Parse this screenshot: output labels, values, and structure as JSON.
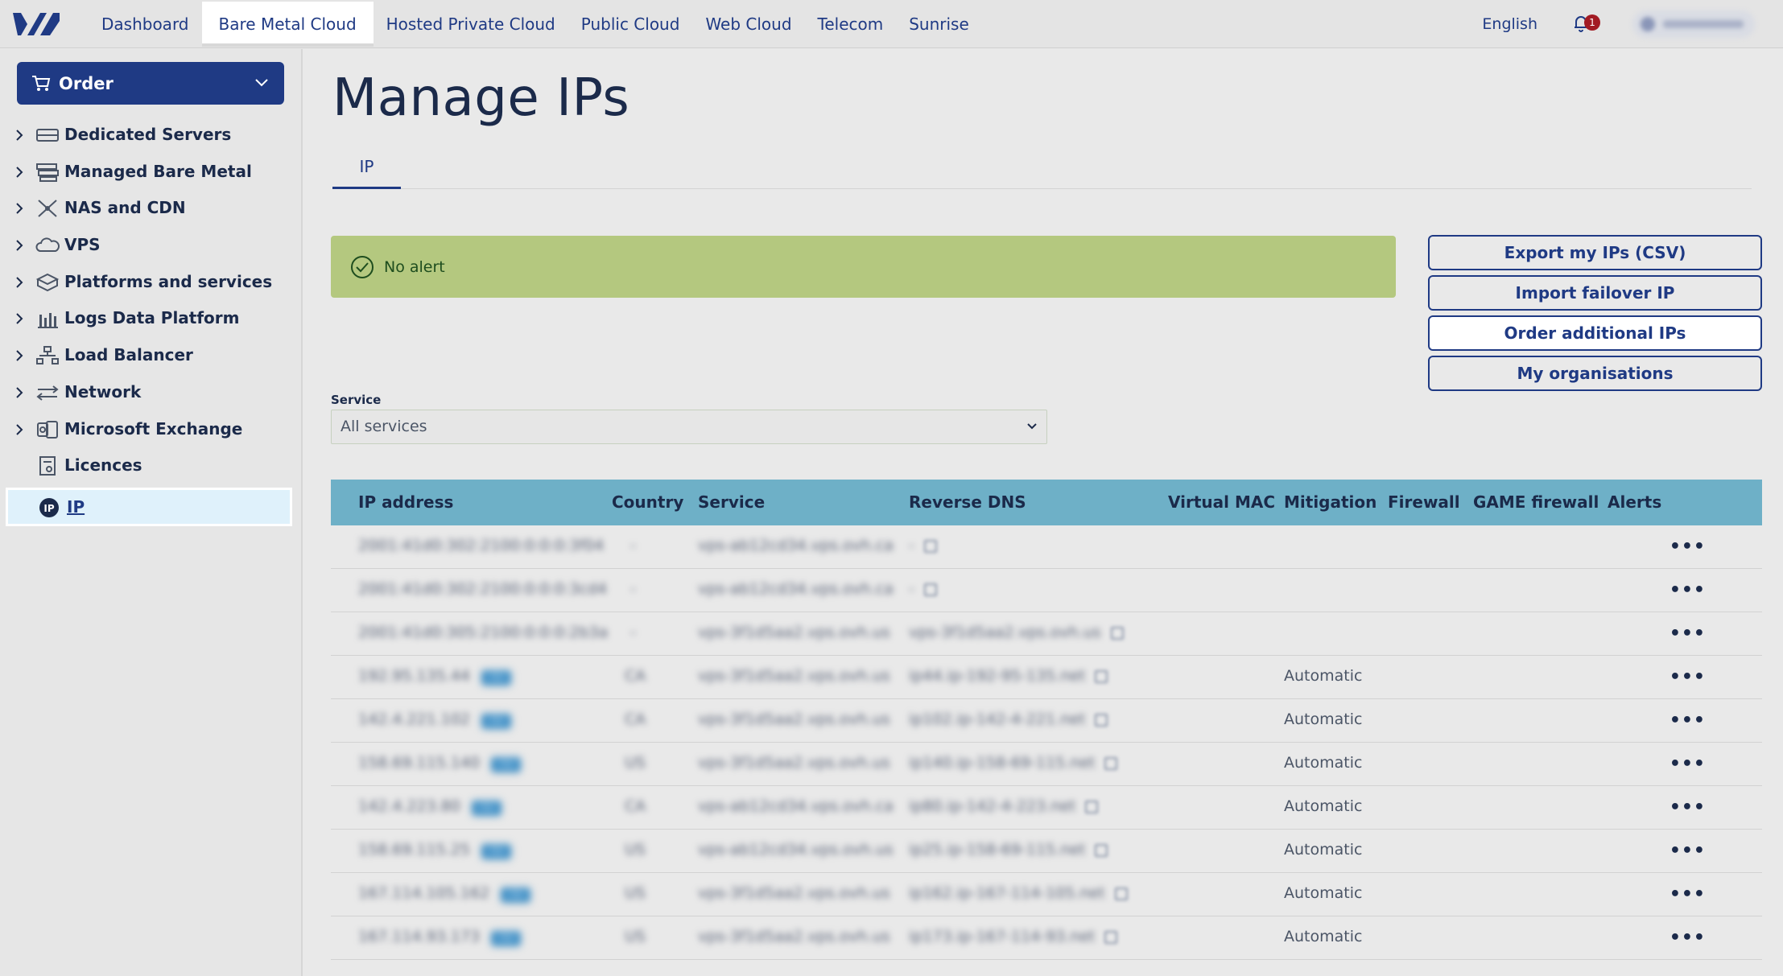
{
  "topnav": {
    "items": [
      {
        "label": "Dashboard",
        "active": false
      },
      {
        "label": "Bare Metal Cloud",
        "active": true
      },
      {
        "label": "Hosted Private Cloud",
        "active": false
      },
      {
        "label": "Public Cloud",
        "active": false
      },
      {
        "label": "Web Cloud",
        "active": false
      },
      {
        "label": "Telecom",
        "active": false
      },
      {
        "label": "Sunrise",
        "active": false
      }
    ],
    "language": "English",
    "notifications_count": "1"
  },
  "sidebar": {
    "order_label": "Order",
    "items": [
      {
        "label": "Dedicated Servers",
        "icon": "server-icon",
        "expandable": true
      },
      {
        "label": "Managed Bare Metal",
        "icon": "stack-icon",
        "expandable": true
      },
      {
        "label": "NAS and CDN",
        "icon": "network-nodes-icon",
        "expandable": true
      },
      {
        "label": "VPS",
        "icon": "cloud-icon",
        "expandable": true
      },
      {
        "label": "Platforms and services",
        "icon": "cubes-icon",
        "expandable": true
      },
      {
        "label": "Logs Data Platform",
        "icon": "bar-chart-icon",
        "expandable": true
      },
      {
        "label": "Load Balancer",
        "icon": "load-balancer-icon",
        "expandable": true
      },
      {
        "label": "Network",
        "icon": "arrows-icon",
        "expandable": true
      },
      {
        "label": "Microsoft Exchange",
        "icon": "exchange-icon",
        "expandable": true
      },
      {
        "label": "Licences",
        "icon": "licence-icon",
        "expandable": false
      },
      {
        "label": "IP",
        "icon": "ip-icon",
        "expandable": false,
        "selected": true
      }
    ]
  },
  "page": {
    "title": "Manage IPs",
    "tab": "IP"
  },
  "alert": {
    "text": "No alert",
    "color": "#b4c87f"
  },
  "actions": {
    "export": "Export my IPs (CSV)",
    "import": "Import failover IP",
    "order": "Order additional IPs",
    "orgs": "My organisations"
  },
  "service_filter": {
    "label": "Service",
    "value": "All services"
  },
  "table": {
    "headers": {
      "ip": "IP address",
      "country": "Country",
      "service": "Service",
      "rdns": "Reverse DNS",
      "mac": "Virtual MAC",
      "mitigation": "Mitigation",
      "firewall": "Firewall",
      "game": "GAME firewall",
      "alerts": "Alerts"
    },
    "rows": [
      {
        "ip": "2001:41d0:302:2100:0:0:0:3f04",
        "tag": "",
        "country": "-",
        "service": "vps-ab12cd34.vps.ovh.ca",
        "rdns": "-",
        "mitigation": ""
      },
      {
        "ip": "2001:41d0:302:2100:0:0:0:3cd4",
        "tag": "",
        "country": "-",
        "service": "vps-ab12cd34.vps.ovh.ca",
        "rdns": "-",
        "mitigation": ""
      },
      {
        "ip": "2001:41d0:305:2100:0:0:0:2b3a",
        "tag": "",
        "country": "-",
        "service": "vps-3f1d5aa2.vps.ovh.us",
        "rdns": "vps-3f1d5aa2.vps.ovh.us",
        "mitigation": ""
      },
      {
        "ip": "192.95.135.44",
        "tag": "/32",
        "country": "CA",
        "service": "vps-3f1d5aa2.vps.ovh.us",
        "rdns": "ip44.ip-192-95-135.net",
        "mitigation": "Automatic"
      },
      {
        "ip": "142.4.221.102",
        "tag": "/32",
        "country": "CA",
        "service": "vps-3f1d5aa2.vps.ovh.us",
        "rdns": "ip102.ip-142-4-221.net",
        "mitigation": "Automatic"
      },
      {
        "ip": "158.69.115.140",
        "tag": "/32",
        "country": "US",
        "service": "vps-3f1d5aa2.vps.ovh.us",
        "rdns": "ip140.ip-158-69-115.net",
        "mitigation": "Automatic"
      },
      {
        "ip": "142.4.223.80",
        "tag": "/32",
        "country": "CA",
        "service": "vps-ab12cd34.vps.ovh.ca",
        "rdns": "ip80.ip-142-4-223.net",
        "mitigation": "Automatic"
      },
      {
        "ip": "158.69.115.25",
        "tag": "/32",
        "country": "US",
        "service": "vps-ab12cd34.vps.ovh.us",
        "rdns": "ip25.ip-158-69-115.net",
        "mitigation": "Automatic"
      },
      {
        "ip": "167.114.105.162",
        "tag": "/32",
        "country": "US",
        "service": "vps-3f1d5aa2.vps.ovh.us",
        "rdns": "ip162.ip-167-114-105.net",
        "mitigation": "Automatic"
      },
      {
        "ip": "167.114.93.173",
        "tag": "/32",
        "country": "US",
        "service": "vps-3f1d5aa2.vps.ovh.us",
        "rdns": "ip173.ip-167-114-93.net",
        "mitigation": "Automatic"
      }
    ]
  },
  "colors": {
    "brand": "#1f3a84",
    "table_header": "#6eb0c7",
    "badge": "#a21b23"
  }
}
